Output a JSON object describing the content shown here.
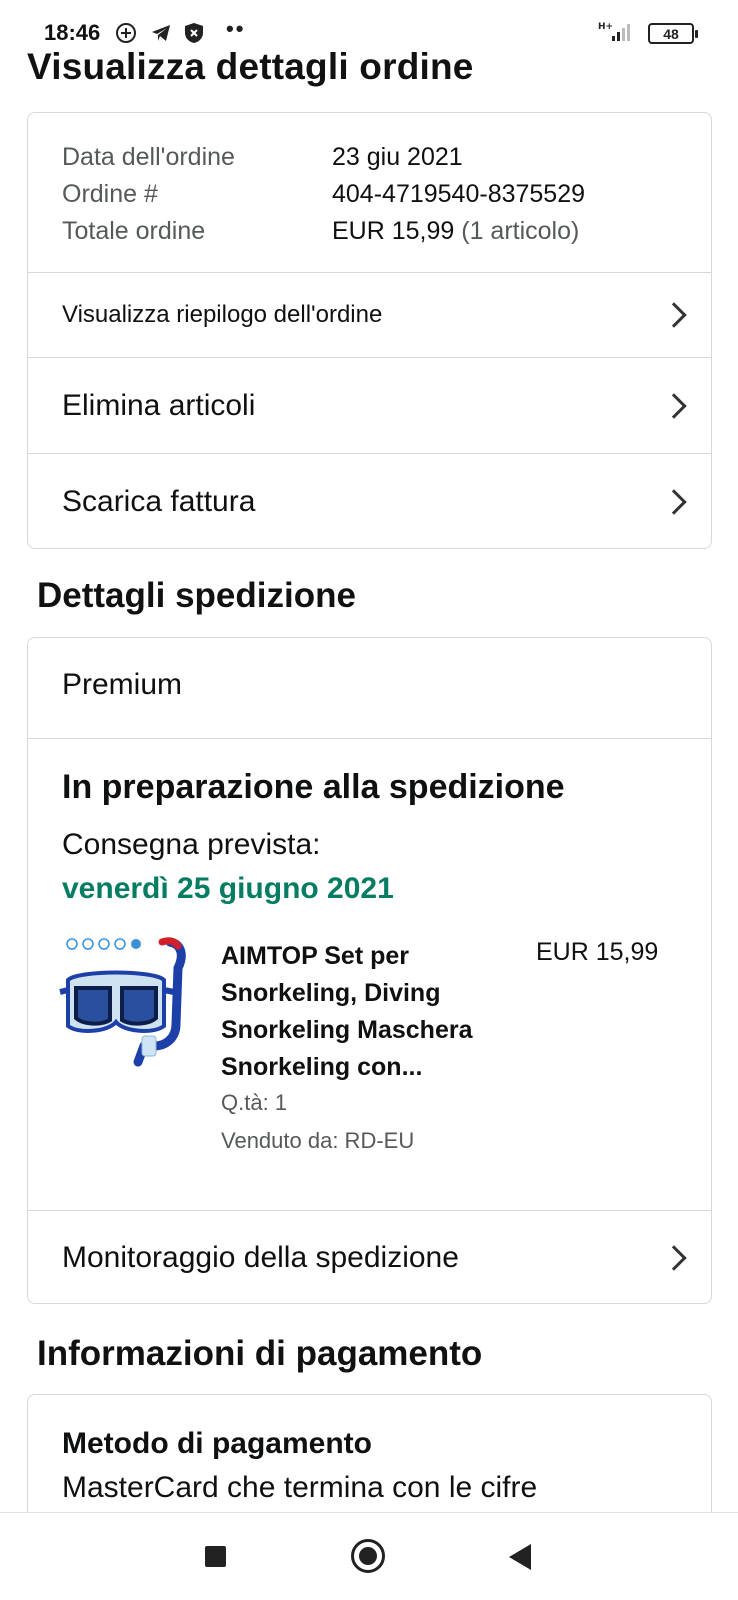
{
  "status_bar": {
    "time": "18:46",
    "battery": "48",
    "network": "H+",
    "icons": [
      "location-plus-icon",
      "telegram-icon",
      "shield-icon",
      "more-dots-icon"
    ]
  },
  "page": {
    "title": "Visualizza dettagli ordine"
  },
  "order_info": {
    "rows": [
      {
        "label": "Data dell'ordine",
        "value": "23 giu 2021",
        "sub": ""
      },
      {
        "label": "Ordine #",
        "value": "404-4719540-8375529",
        "sub": ""
      },
      {
        "label": "Totale ordine",
        "value": "EUR 15,99",
        "sub": "(1 articolo)"
      }
    ],
    "actions": [
      {
        "label": "Visualizza riepilogo dell'ordine"
      },
      {
        "label": "Elimina articoli"
      },
      {
        "label": "Scarica fattura"
      }
    ]
  },
  "shipping": {
    "section_title": "Dettagli spedizione",
    "method": "Premium",
    "status": "In preparazione alla spedizione",
    "expected_label": "Consegna prevista:",
    "expected_date": "venerdì 25 giugno 2021",
    "product": {
      "title": "AIMTOP Set per Snorkeling, Diving Snorkeling Maschera Snorkeling con...",
      "price": "EUR 15,99",
      "qty": "Q.tà: 1",
      "seller": "Venduto da: RD-EU"
    },
    "tracking_label": "Monitoraggio della spedizione"
  },
  "payment": {
    "section_title": "Informazioni di pagamento",
    "method_title": "Metodo di pagamento",
    "method_partial": "MasterCard che termina con le cifre"
  },
  "colors": {
    "delivery_green": "#067d62",
    "border": "#d5d9d9",
    "secondary_text": "#565959"
  }
}
